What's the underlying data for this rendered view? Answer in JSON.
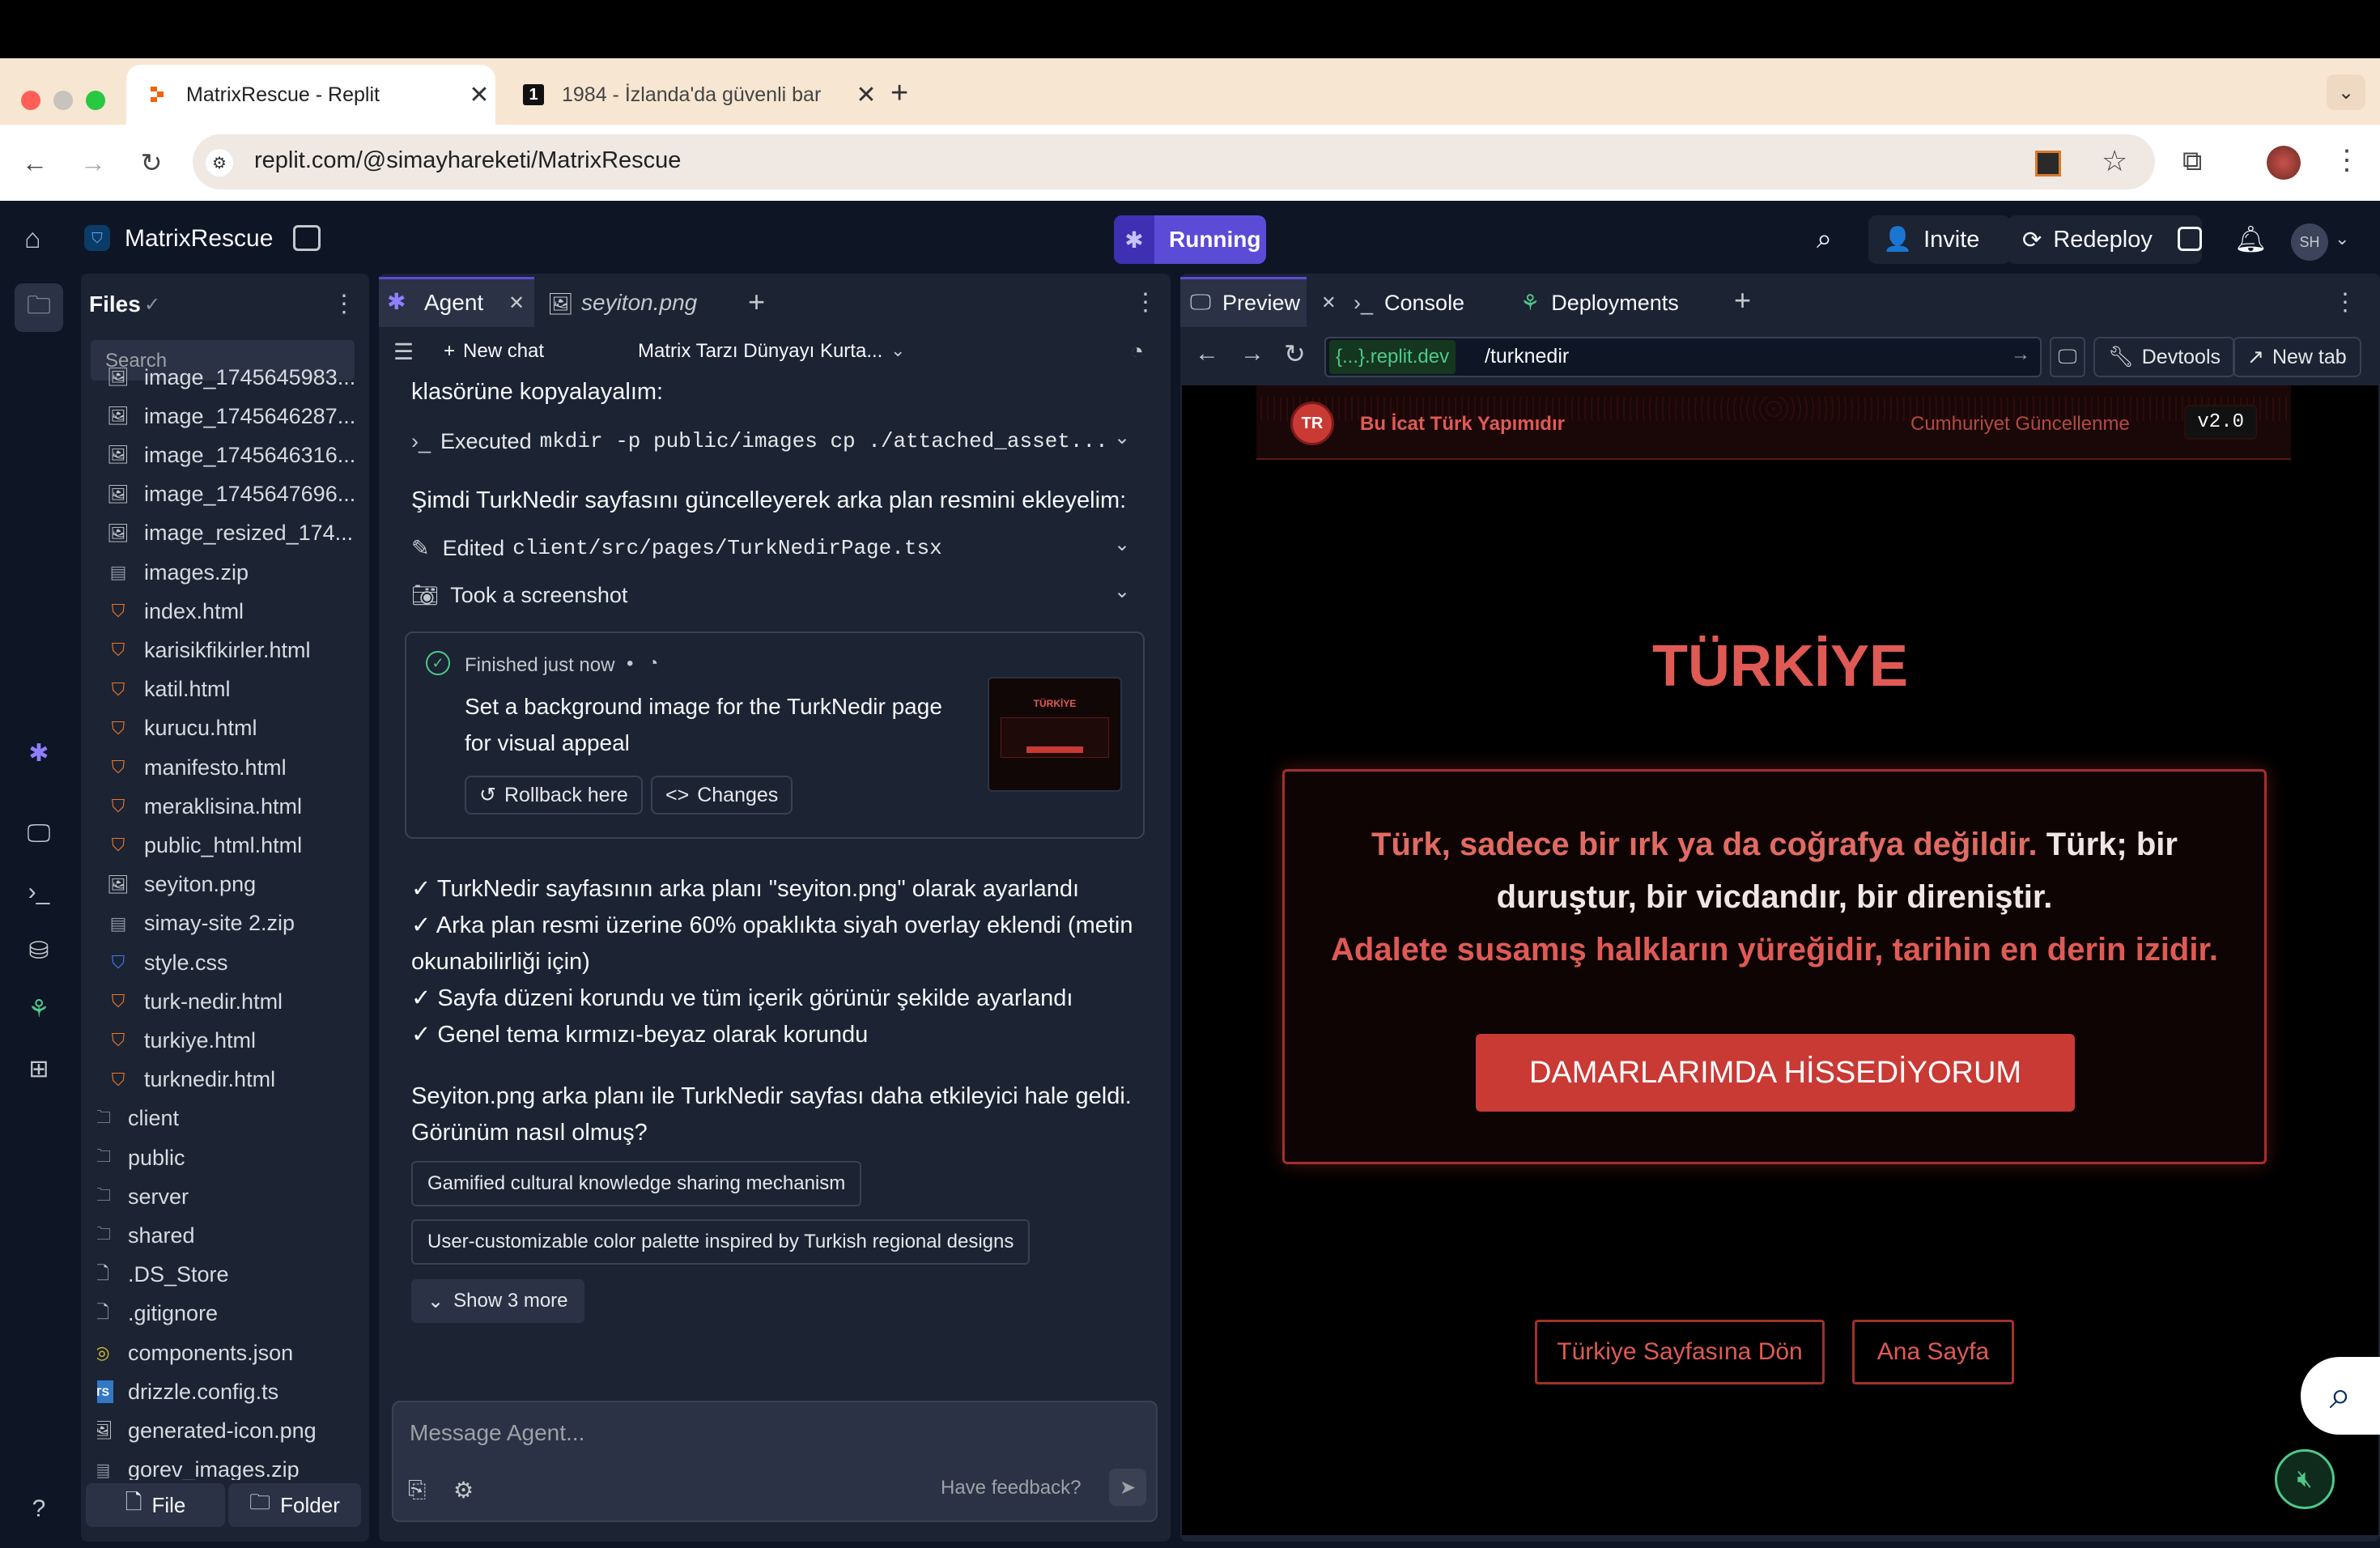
{
  "browser": {
    "tabs": [
      {
        "title": "MatrixRescue - Replit"
      },
      {
        "title": "1984 - İzlanda'da güvenli bar"
      }
    ],
    "url": "replit.com/@simayhareketi/MatrixRescue"
  },
  "header": {
    "project_name": "MatrixRescue",
    "run_status": "Running",
    "invite": "Invite",
    "redeploy": "Redeploy",
    "avatar": "SH"
  },
  "files": {
    "title": "Files",
    "search_placeholder": "Search",
    "items": [
      {
        "name": "image_1745645983...",
        "type": "image"
      },
      {
        "name": "image_1745646287...",
        "type": "image"
      },
      {
        "name": "image_1745646316...",
        "type": "image"
      },
      {
        "name": "image_1745647696...",
        "type": "image"
      },
      {
        "name": "image_resized_174...",
        "type": "image"
      },
      {
        "name": "images.zip",
        "type": "zip"
      },
      {
        "name": "index.html",
        "type": "html"
      },
      {
        "name": "karisikfikirler.html",
        "type": "html"
      },
      {
        "name": "katil.html",
        "type": "html"
      },
      {
        "name": "kurucu.html",
        "type": "html"
      },
      {
        "name": "manifesto.html",
        "type": "html"
      },
      {
        "name": "meraklisina.html",
        "type": "html"
      },
      {
        "name": "public_html.html",
        "type": "html"
      },
      {
        "name": "seyiton.png",
        "type": "image"
      },
      {
        "name": "simay-site 2.zip",
        "type": "zip"
      },
      {
        "name": "style.css",
        "type": "css"
      },
      {
        "name": "turk-nedir.html",
        "type": "html"
      },
      {
        "name": "turkiye.html",
        "type": "html"
      },
      {
        "name": "turknedir.html",
        "type": "html"
      }
    ],
    "root_items": [
      {
        "name": "client",
        "type": "folder"
      },
      {
        "name": "public",
        "type": "folder"
      },
      {
        "name": "server",
        "type": "folder"
      },
      {
        "name": "shared",
        "type": "folder"
      },
      {
        "name": ".DS_Store",
        "type": "file"
      },
      {
        "name": ".gitignore",
        "type": "file"
      },
      {
        "name": "components.json",
        "type": "json"
      },
      {
        "name": "drizzle.config.ts",
        "type": "ts"
      },
      {
        "name": "generated-icon.png",
        "type": "image"
      },
      {
        "name": "gorev_images.zip",
        "type": "zip"
      }
    ],
    "new_file": "File",
    "new_folder": "Folder"
  },
  "agent": {
    "tab_agent": "Agent",
    "tab_file": "seyiton.png",
    "new_chat": "New chat",
    "chat_title": "Matrix Tarzı Dünyayı Kurta...",
    "line_top": "klasörüne kopyalayalım:",
    "executed_label": "Executed",
    "executed_cmd": "mkdir -p public/images cp ./attached_asset...",
    "line_update": "Şimdi TurkNedir sayfasını güncelleyerek arka plan resmini ekleyelim:",
    "edited_label": "Edited",
    "edited_file": "client/src/pages/TurkNedirPage.tsx",
    "screenshot": "Took a screenshot",
    "checkpoint": {
      "status": "Finished just now",
      "description": "Set a background image for the TurkNedir page for visual appeal",
      "rollback": "Rollback here",
      "changes": "Changes",
      "thumb_title": "TÜRKİYE"
    },
    "summary": [
      "✓ TurkNedir sayfasının arka planı \"seyiton.png\" olarak ayarlandı",
      "✓ Arka plan resmi üzerine 60% opaklıkta siyah overlay eklendi (metin okunabilirliği için)",
      "✓ Sayfa düzeni korundu ve tüm içerik görünür şekilde ayarlandı",
      "✓ Genel tema kırmızı-beyaz olarak korundu"
    ],
    "closing": "Seyiton.png arka planı ile TurkNedir sayfası daha etkileyici hale geldi. Görünüm nasıl olmuş?",
    "suggestions": [
      "Gamified cultural knowledge sharing mechanism",
      "User-customizable color palette inspired by Turkish regional designs"
    ],
    "show_more": "Show 3 more",
    "input_placeholder": "Message Agent...",
    "feedback": "Have feedback?"
  },
  "preview": {
    "tab_preview": "Preview",
    "tab_console": "Console",
    "tab_deployments": "Deployments",
    "domain": "{...}.replit.dev",
    "path": "/turknedir",
    "devtools": "Devtools",
    "new_tab": "New tab",
    "site": {
      "badge": "TR",
      "banner_left": "Bu İcat Türk Yapımıdır",
      "banner_right": "Cumhuriyet Güncellenme",
      "version": "v2.0",
      "heading": "TÜRKİYE",
      "quote_line1_colored": "Türk, sadece bir ırk ya da coğrafya değildir.",
      "quote_line1_white": " Türk; bir",
      "quote_line2_white": "duruştur, bir vicdandır, bir direniştir.",
      "quote_line3": "Adalete susamış halkların yüreğidir, tarihin en derin izidir.",
      "cta": "DAMARLARIMDA HİSSEDİYORUM",
      "back_button": "Türkiye Sayfasına Dön",
      "home_button": "Ana Sayfa"
    }
  },
  "colors": {
    "replit_bg": "#0e1525",
    "panel_bg": "#1c2333",
    "accent_purple": "#5b4bd6",
    "site_red": "#e05a55",
    "button_red": "#c93a35"
  }
}
